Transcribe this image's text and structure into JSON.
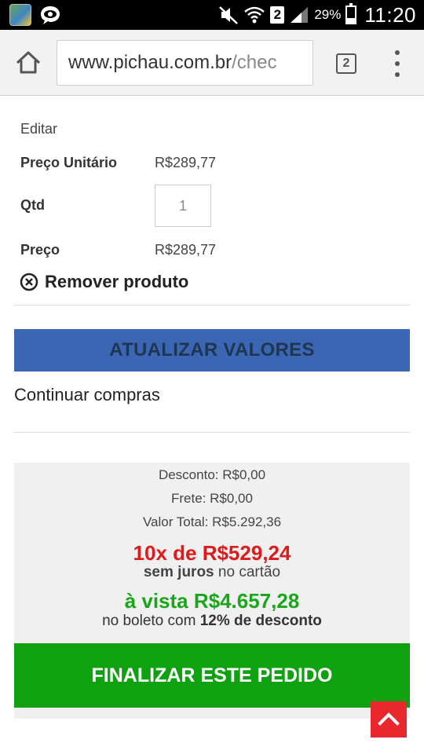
{
  "status_bar": {
    "battery_percent": "29%",
    "battery_level": 0.29,
    "sim_badge": "2",
    "time": "11:20"
  },
  "browser": {
    "url_main": "www.pichau.com.br",
    "url_path": "/chec",
    "tab_count": "2"
  },
  "cart_item": {
    "edit_label": "Editar",
    "unit_price_label": "Preço Unitário",
    "unit_price_value": "R$289,77",
    "qty_label": "Qtd",
    "qty_value": "1",
    "price_label": "Preço",
    "price_value": "R$289,77",
    "remove_label": "Remover produto"
  },
  "actions": {
    "update_label": "ATUALIZAR VALORES",
    "continue_label": "Continuar compras"
  },
  "summary": {
    "discount_line": "Desconto: R$0,00",
    "shipping_line": "Frete: R$0,00",
    "total_line": "Valor Total: R$5.292,36",
    "installments_line": "10x de R$529,24",
    "installments_bold": "sem juros",
    "installments_rest": " no cartão",
    "cash_line": "à vista R$4.657,28",
    "cash_prefix": "no boleto com ",
    "cash_bold": "12% de desconto",
    "finalize_label": "FINALIZAR ESTE PEDIDO"
  },
  "colors": {
    "update_button": "#3a66b4",
    "finalize_button": "#0fa10f",
    "installments_red": "#e0191b",
    "cash_green": "#1aa61a",
    "scroll_top_button": "#e8282c"
  }
}
